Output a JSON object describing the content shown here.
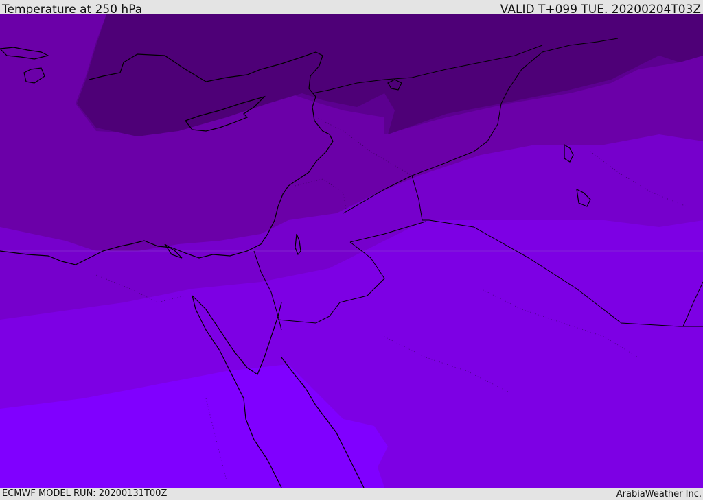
{
  "header": {
    "title": "Temperature at 250 hPa",
    "valid_time": "VALID T+099 TUE. 20200204T03Z"
  },
  "footer": {
    "model_run": "ECMWF MODEL RUN: 20200131T00Z",
    "credit": "ArabiaWeather Inc."
  },
  "map": {
    "region": "Eastern Mediterranean, Levant, Egypt, Arabia",
    "colors": {
      "band_darkest": "#4e0077",
      "band_dark": "#5c0090",
      "band_mid": "#6b00a8",
      "band_lighter": "#7600cc",
      "band_bright": "#7d00e4",
      "band_brightest": "#8000ff",
      "coastline": "#000000"
    }
  }
}
